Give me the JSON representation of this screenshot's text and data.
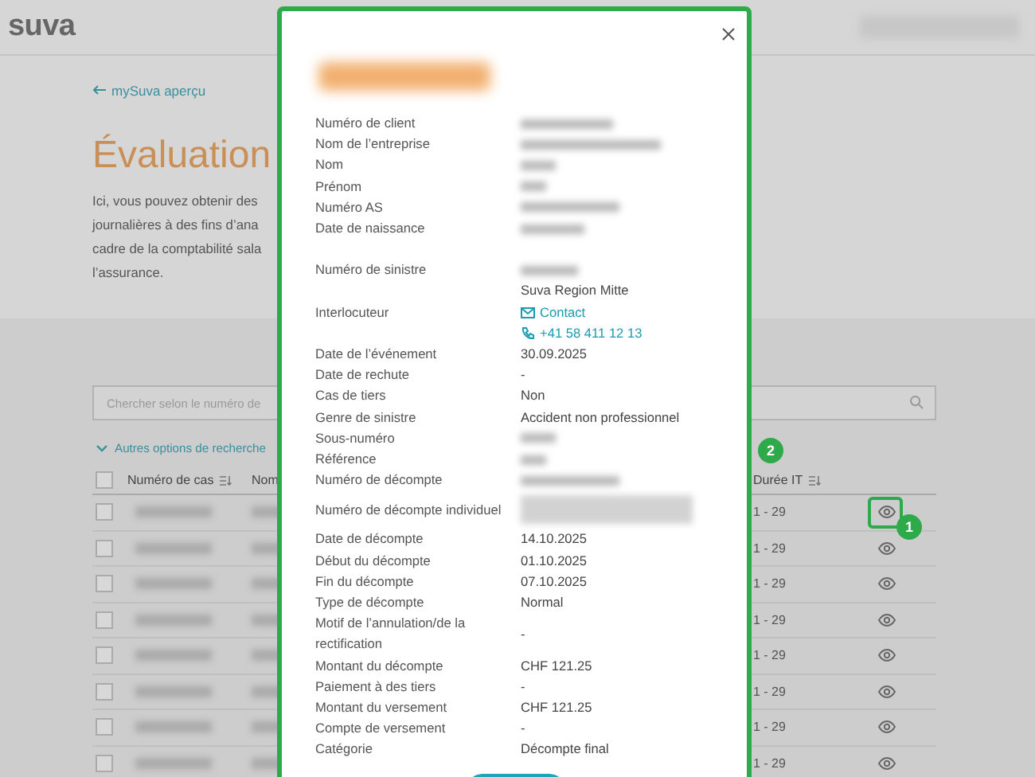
{
  "header": {
    "logo": "suva"
  },
  "back_link": "mySuva aperçu",
  "title": "Évaluation",
  "intro_lines": [
    "Ici, vous pouvez obtenir des",
    "journalières à des fins d’ana",
    "cadre de la comptabilité sala",
    "l’assurance."
  ],
  "search": {
    "placeholder": "Chercher selon le numéro de"
  },
  "more_options": "Autres options de recherche",
  "table": {
    "all_checked": false,
    "columns": [
      "Numéro de cas",
      "Nom",
      "Durée IT"
    ],
    "rows": [
      {
        "checked": false,
        "duration": "1 - 29",
        "highlighted": true,
        "marker": "1"
      },
      {
        "checked": false,
        "duration": "1 - 29",
        "highlighted": false
      },
      {
        "checked": false,
        "duration": "1 - 29",
        "highlighted": false
      },
      {
        "checked": false,
        "duration": "1 - 29",
        "highlighted": false
      },
      {
        "checked": false,
        "duration": "1 - 29",
        "highlighted": false
      },
      {
        "checked": false,
        "duration": "1 - 29",
        "highlighted": false
      },
      {
        "checked": false,
        "duration": "1 - 29",
        "highlighted": false
      },
      {
        "checked": false,
        "duration": "1 - 29",
        "highlighted": false
      }
    ]
  },
  "modal": {
    "marker": "2",
    "groups": [
      [
        {
          "label": "Numéro de client",
          "kind": "blurred"
        },
        {
          "label": "Nom de l’entreprise",
          "kind": "blurred"
        },
        {
          "label": "Nom",
          "kind": "blurred"
        },
        {
          "label": "Prénom",
          "kind": "blurred"
        },
        {
          "label": "Numéro AS",
          "kind": "blurred"
        },
        {
          "label": "Date de naissance",
          "kind": "blurred"
        }
      ],
      [
        {
          "label": "Numéro de sinistre",
          "kind": "blurred"
        },
        {
          "label": "Interlocuteur",
          "kind": "contact",
          "organisation": "Suva Region Mitte",
          "email": "Contact",
          "phone": "+41 58 411 12 13"
        },
        {
          "label": "Date de l’événement",
          "kind": "text",
          "value": "30.09.2025"
        },
        {
          "label": "Date de rechute",
          "kind": "text",
          "value": "-"
        },
        {
          "label": "Cas de tiers",
          "kind": "text",
          "value": "Non"
        },
        {
          "label": "Genre de sinistre",
          "kind": "text",
          "value": "Accident non professionnel"
        },
        {
          "label": "Sous-numéro",
          "kind": "blurred"
        },
        {
          "label": "Référence",
          "kind": "blurred"
        },
        {
          "label": "Numéro de décompte",
          "kind": "blurred"
        },
        {
          "label": "Numéro de décompte individuel",
          "kind": "blurred_block"
        },
        {
          "label": "Date de décompte",
          "kind": "text",
          "value": "14.10.2025"
        },
        {
          "label": "Début du décompte",
          "kind": "text",
          "value": "01.10.2025"
        },
        {
          "label": "Fin du décompte",
          "kind": "text",
          "value": "07.10.2025"
        },
        {
          "label": "Type de décompte",
          "kind": "text",
          "value": "Normal"
        },
        {
          "label": "Motif de l’annulation/de la rectification",
          "kind": "text",
          "value": "-"
        },
        {
          "label": "Montant du décompte",
          "kind": "text",
          "value": "CHF 121.25"
        },
        {
          "label": "Paiement à des tiers",
          "kind": "text",
          "value": "-"
        },
        {
          "label": "Montant du versement",
          "kind": "text",
          "value": "CHF 121.25"
        },
        {
          "label": "Compte de versement",
          "kind": "text",
          "value": "-"
        },
        {
          "label": "Catégorie",
          "kind": "text",
          "value": "Décompte final"
        }
      ]
    ]
  }
}
